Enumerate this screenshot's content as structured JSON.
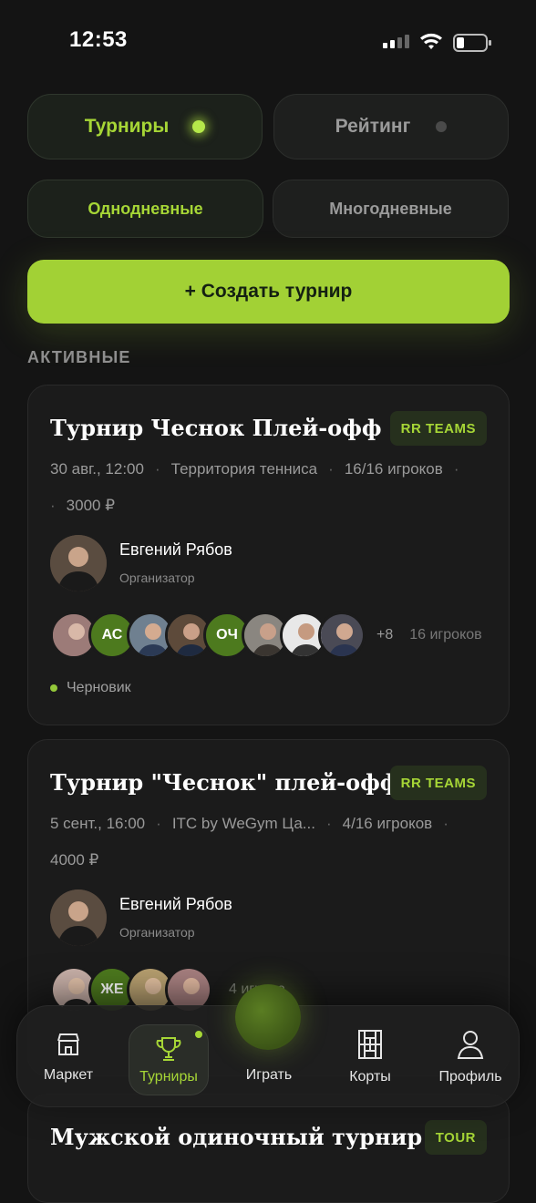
{
  "status_bar": {
    "time": "12:53"
  },
  "segments": {
    "main": [
      {
        "label": "Турниры",
        "active": true
      },
      {
        "label": "Рейтинг",
        "active": false
      }
    ],
    "duration": [
      {
        "label": "Однодневные",
        "active": true
      },
      {
        "label": "Многодневные",
        "active": false
      }
    ]
  },
  "create_button": "+ Создать турнир",
  "section_label": "АКТИВНЫЕ",
  "cards": [
    {
      "title": "Турнир Чеснок Плей-офф",
      "badge": "RR TEAMS",
      "date": "30 авг., 12:00",
      "location": "Территория тенниса",
      "players": "16/16 игроков",
      "price": "3000 ₽",
      "organizer_name": "Евгений Рябов",
      "organizer_role": "Организатор",
      "avatars": [
        "photo",
        "АС",
        "photo",
        "photo",
        "ОЧ",
        "photo",
        "photo",
        "photo"
      ],
      "more": "+8",
      "count": "16 игроков",
      "status": "Черновик"
    },
    {
      "title": "Турнир \"Чеснок\" плей-офф",
      "badge": "RR TEAMS",
      "date": "5 сент., 16:00",
      "location": "ITC by WeGym Ца...",
      "players": "4/16 игроков",
      "price": "4000 ₽",
      "organizer_name": "Евгений Рябов",
      "organizer_role": "Организатор",
      "avatars": [
        "photo",
        "ЖЕ",
        "photo",
        "photo"
      ],
      "count": "4 игрока"
    },
    {
      "title": "Мужской одиночный турнир",
      "badge": "TOUR"
    }
  ],
  "nav": [
    {
      "label": "Маркет",
      "icon": "store-icon"
    },
    {
      "label": "Турниры",
      "icon": "trophy-icon",
      "active": true
    },
    {
      "label": "Играть",
      "icon": "tennis-ball-icon"
    },
    {
      "label": "Корты",
      "icon": "court-icon"
    },
    {
      "label": "Профиль",
      "icon": "user-icon"
    }
  ],
  "colors": {
    "accent": "#a2d135",
    "background": "#141414",
    "card": "#1b1b1b"
  }
}
